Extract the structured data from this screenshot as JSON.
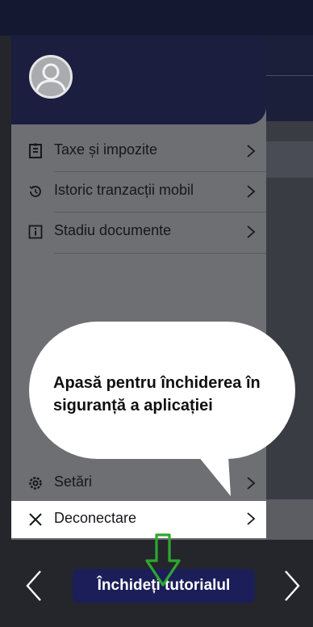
{
  "menu": {
    "items": [
      {
        "icon": "receipt-icon",
        "label": "Taxe și impozite"
      },
      {
        "icon": "history-icon",
        "label": "Istoric tranzacții mobil"
      },
      {
        "icon": "info-icon",
        "label": "Stadiu documente"
      }
    ],
    "settings": {
      "icon": "gear-icon",
      "label": "Setări"
    },
    "logout": {
      "icon": "close-icon",
      "label": "Deconectare"
    }
  },
  "tooltip": {
    "text": "Apasă pentru închiderea în siguranță a aplicației"
  },
  "tutorial": {
    "close_label": "Închideți tutorialul",
    "prev_icon": "chevron-left-icon",
    "next_icon": "chevron-right-icon"
  },
  "colors": {
    "header_navy": "#1b1e3e",
    "button_navy": "#1b1e58",
    "pointer_green": "#2ea82e"
  }
}
